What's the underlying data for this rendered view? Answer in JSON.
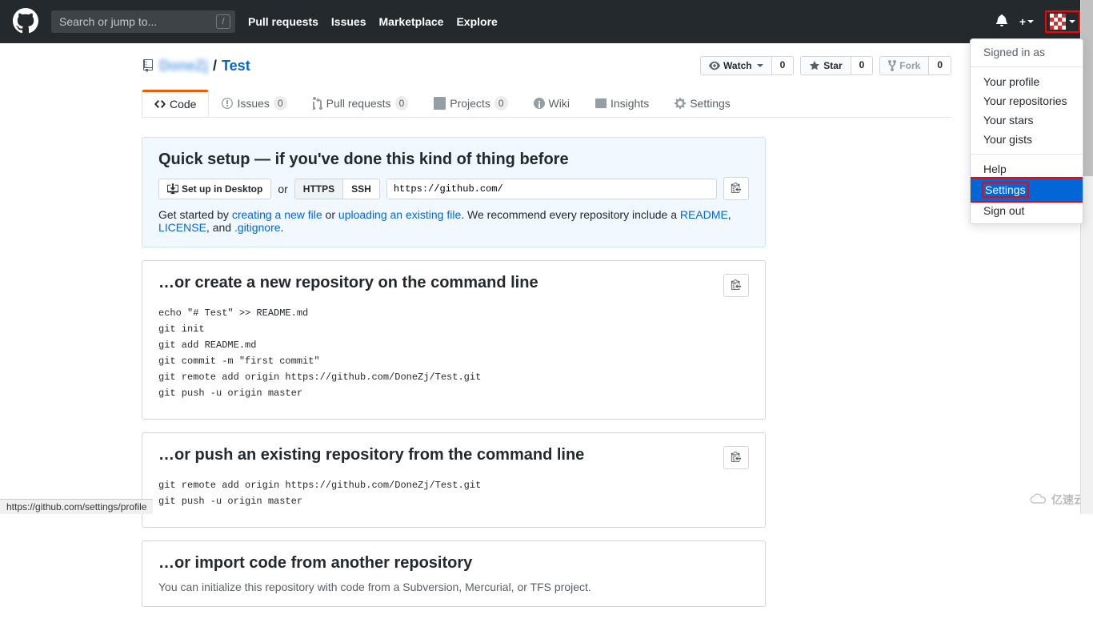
{
  "header": {
    "search_placeholder": "Search or jump to...",
    "slash": "/",
    "nav": {
      "pulls": "Pull requests",
      "issues": "Issues",
      "marketplace": "Marketplace",
      "explore": "Explore"
    },
    "plus": "+"
  },
  "dropdown": {
    "signed_in_as": "Signed in as",
    "your_profile": "Your profile",
    "your_repositories": "Your repositories",
    "your_stars": "Your stars",
    "your_gists": "Your gists",
    "help": "Help",
    "settings": "Settings",
    "sign_out": "Sign out"
  },
  "repo": {
    "owner": "DoneZj",
    "sep": "/",
    "name": "Test",
    "watch_label": "Watch",
    "watch_count": "0",
    "star_label": "Star",
    "star_count": "0",
    "fork_label": "Fork",
    "fork_count": "0"
  },
  "tabs": {
    "code": "Code",
    "issues": "Issues",
    "issues_count": "0",
    "pulls": "Pull requests",
    "pulls_count": "0",
    "projects": "Projects",
    "projects_count": "0",
    "wiki": "Wiki",
    "insights": "Insights",
    "settings": "Settings"
  },
  "quicksetup": {
    "title": "Quick setup — if you've done this kind of thing before",
    "desktop_btn": "Set up in Desktop",
    "or": "or",
    "https": "HTTPS",
    "ssh": "SSH",
    "url": "https://github.com/",
    "desc_prefix": "Get started by ",
    "create_file": "creating a new file",
    "desc_or": " or ",
    "upload_file": "uploading an existing file",
    "desc_mid": ". We recommend every repository include a ",
    "readme": "README",
    "comma1": ", ",
    "license": "LICENSE",
    "comma2": ", and ",
    "gitignore": ".gitignore",
    "period": "."
  },
  "section1": {
    "title": "…or create a new repository on the command line",
    "code": "echo \"# Test\" >> README.md\ngit init\ngit add README.md\ngit commit -m \"first commit\"\ngit remote add origin https://github.com/DoneZj/Test.git\ngit push -u origin master"
  },
  "section2": {
    "title": "…or push an existing repository from the command line",
    "code": "git remote add origin https://github.com/DoneZj/Test.git\ngit push -u origin master"
  },
  "section3": {
    "title": "…or import code from another repository",
    "desc": "You can initialize this repository with code from a Subversion, Mercurial, or TFS project."
  },
  "status_url": "https://github.com/settings/profile",
  "watermark": "亿速云"
}
